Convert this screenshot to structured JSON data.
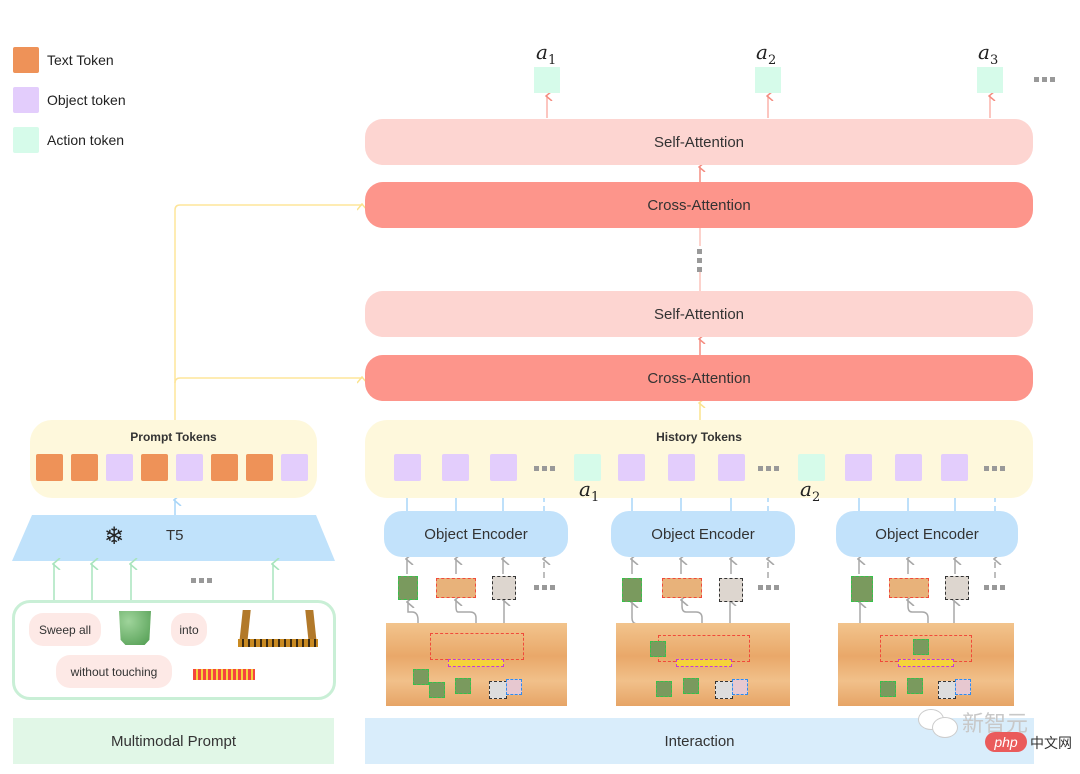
{
  "legend": [
    {
      "label": "Text Token",
      "color": "#ee9258"
    },
    {
      "label": "Object token",
      "color": "#e3cdfc"
    },
    {
      "label": "Action token",
      "color": "#d6fbea"
    }
  ],
  "outputs": {
    "actions": [
      {
        "symbol": "a",
        "sub": "1"
      },
      {
        "symbol": "a",
        "sub": "2"
      },
      {
        "symbol": "a",
        "sub": "3"
      }
    ]
  },
  "decoder": {
    "top_self_attention": "Self-Attention",
    "top_cross_attention": "Cross-Attention",
    "bottom_self_attention": "Self-Attention",
    "bottom_cross_attention": "Cross-Attention"
  },
  "prompt_tokens": {
    "title": "Prompt Tokens",
    "sequence": [
      "text",
      "text",
      "object",
      "text",
      "object",
      "text",
      "text",
      "object"
    ]
  },
  "t5": {
    "label": "T5",
    "frozen_icon": "snowflake-icon"
  },
  "multimodal_prompt": {
    "words": [
      "Sweep all",
      "into",
      "without touching"
    ],
    "images": [
      "green-cube-image",
      "three-sided-frame-image",
      "striped-line-image"
    ],
    "footer": "Multimodal Prompt"
  },
  "history_tokens": {
    "title": "History Tokens",
    "groups": [
      {
        "objects": 3,
        "action": {
          "symbol": "a",
          "sub": "1"
        }
      },
      {
        "objects": 3,
        "action": {
          "symbol": "a",
          "sub": "2"
        }
      },
      {
        "objects": 3,
        "action": null
      }
    ]
  },
  "encoders": {
    "label": "Object Encoder",
    "count": 3
  },
  "interaction": {
    "footer": "Interaction"
  },
  "watermark": {
    "text1": "新智元",
    "text2": "php",
    "text3": "中文网"
  },
  "colors": {
    "text_token": "#ee9258",
    "object_token": "#e3cdfc",
    "action_token": "#d6fbea",
    "self_attention": "#fdd5d1",
    "cross_attention": "#fd958b",
    "token_panel": "#fef8dc",
    "encoder": "#c2e2fb",
    "prompt_footer": "#e1f7e7",
    "interaction_footer": "#d9edfb"
  }
}
